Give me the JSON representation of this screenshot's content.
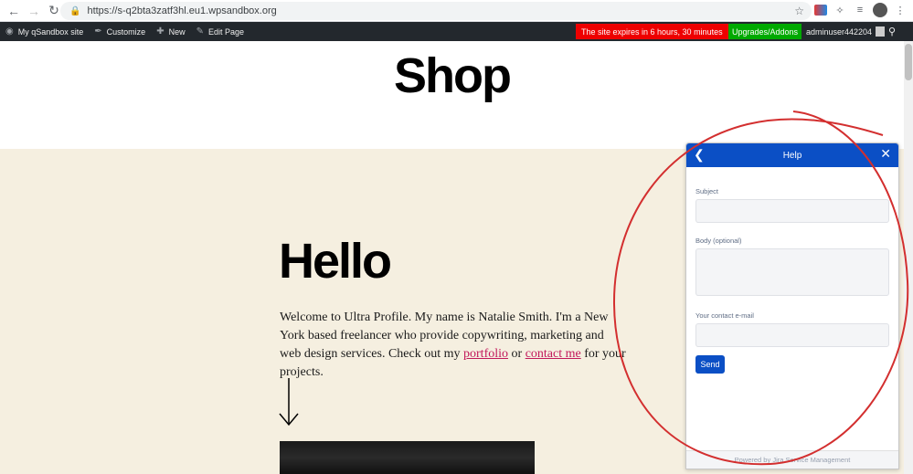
{
  "browser": {
    "url": "https://s-q2bta3zatf3hl.eu1.wpsandbox.org",
    "back_icon": "arrow-left-icon",
    "forward_icon": "arrow-right-icon",
    "reload_icon": "reload-icon"
  },
  "wp_admin": {
    "site_name": "My qSandbox site",
    "customize": "Customize",
    "new": "New",
    "edit_page": "Edit Page",
    "expire_text": "The site expires in  6 hours, 30 minutes",
    "upgrade": "Upgrades/Addons",
    "user": "adminuser442204",
    "colors": {
      "bar": "#23282d",
      "expire": "#ee0000",
      "upgrade": "#00aa00"
    }
  },
  "page": {
    "title": "Shop",
    "heading": "Hello",
    "intro_before": "Welcome to Ultra Profile. My name is Natalie Smith. I'm a New York based freelancer who provide copywriting, marketing and web design services. Check out my ",
    "portfolio_link": "portfolio",
    "intro_mid": " or ",
    "contact_link": "contact me",
    "intro_after": " for your projects."
  },
  "help_widget": {
    "title": "Help",
    "subject_label": "Subject",
    "body_label": "Body (optional)",
    "email_label": "Your contact e-mail",
    "send_label": "Send",
    "footer": "Powered by Jira Service Management",
    "accent": "#0b4fc5"
  }
}
